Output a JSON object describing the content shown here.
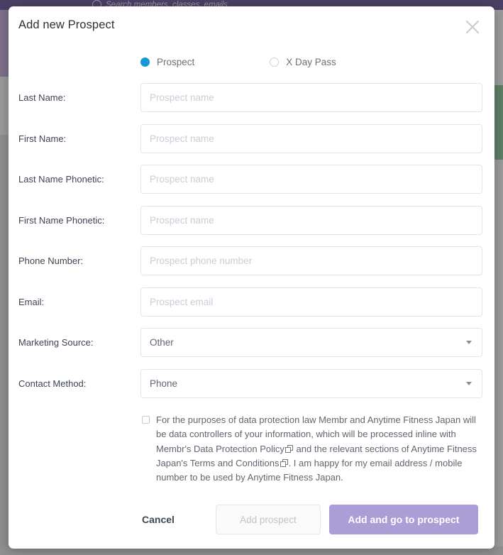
{
  "background": {
    "search_placeholder": "Search members, classes, emails",
    "search_icon": "search-icon",
    "topbar_color": "#4a4065",
    "accent_green": "#5d7f66"
  },
  "modal": {
    "title": "Add new Prospect",
    "close_icon": "close-icon",
    "type_options": [
      {
        "label": "Prospect",
        "selected": true
      },
      {
        "label": "X Day Pass",
        "selected": false
      }
    ],
    "fields": [
      {
        "label": "Last Name:",
        "placeholder": "Prospect name",
        "value": "",
        "type": "text",
        "name": "last-name"
      },
      {
        "label": "First Name:",
        "placeholder": "Prospect name",
        "value": "",
        "type": "text",
        "name": "first-name"
      },
      {
        "label": "Last Name Phonetic:",
        "placeholder": "Prospect name",
        "value": "",
        "type": "text",
        "name": "last-name-phonetic"
      },
      {
        "label": "First Name Phonetic:",
        "placeholder": "Prospect name",
        "value": "",
        "type": "text",
        "name": "first-name-phonetic"
      },
      {
        "label": "Phone Number:",
        "placeholder": "Prospect phone number",
        "value": "",
        "type": "text",
        "name": "phone-number"
      },
      {
        "label": "Email:",
        "placeholder": "Prospect email",
        "value": "",
        "type": "text",
        "name": "email"
      }
    ],
    "selects": [
      {
        "label": "Marketing Source:",
        "value": "Other",
        "name": "marketing-source",
        "caret_icon": "chevron-down-icon"
      },
      {
        "label": "Contact Method:",
        "value": "Phone",
        "name": "contact-method",
        "caret_icon": "chevron-down-icon"
      }
    ],
    "consent": {
      "checked": false,
      "part1": "For the purposes of data protection law Membr and Anytime Fitness Japan will be data controllers of your information, which will be processed inline with Membr's Data Protection Policy",
      "link_icon_1": "external-link-icon",
      "part2": " and the relevant sections of Anytime Fitness Japan's Terms and Conditions",
      "link_icon_2": "external-link-icon",
      "part3": ". I am happy for my email address / mobile number to be used by Anytime Fitness Japan."
    },
    "footer": {
      "cancel_label": "Cancel",
      "add_prospect_label": "Add prospect",
      "add_prospect_disabled": true,
      "add_and_go_label": "Add and go to prospect",
      "primary_color": "#ab9ed7"
    }
  }
}
